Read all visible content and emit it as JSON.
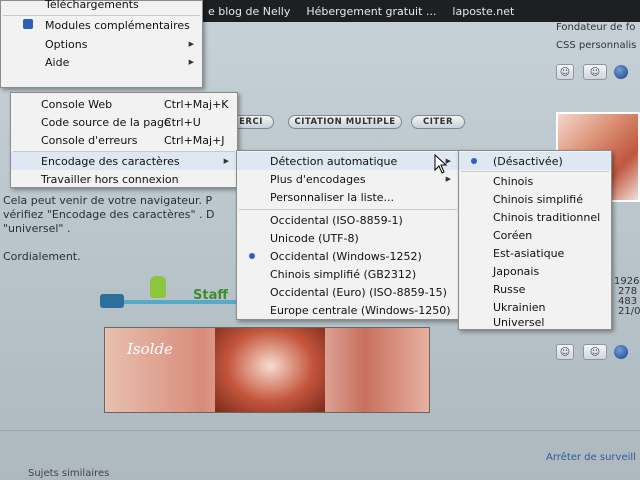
{
  "browser_tabs": [
    "e blog de Nelly",
    "Hébergement gratuit ...",
    "laposte.net"
  ],
  "tools_menu": {
    "partial_top": "Téléchargements",
    "items": [
      {
        "label": "Modules complémentaires",
        "icon": "puzzle-icon"
      },
      {
        "label": "Options"
      },
      {
        "label": "Aide"
      }
    ]
  },
  "dev_menu": {
    "items": [
      {
        "label": "Console Web",
        "shortcut": "Ctrl+Maj+K"
      },
      {
        "label": "Code source de la page",
        "shortcut": "Ctrl+U"
      },
      {
        "label": "Console d'erreurs",
        "shortcut": "Ctrl+Maj+J"
      },
      {
        "label": "Encodage des caractères"
      },
      {
        "label": "Travailler hors connexion"
      }
    ]
  },
  "encoding_menu": {
    "items": [
      {
        "label": "Détection automatique"
      },
      {
        "label": "Plus d'encodages"
      },
      {
        "label": "Personnaliser la liste..."
      },
      {
        "label": "Occidental (ISO-8859-1)"
      },
      {
        "label": "Unicode (UTF-8)"
      },
      {
        "label": "Occidental (Windows-1252)",
        "selected": true
      },
      {
        "label": "Chinois simplifié (GB2312)"
      },
      {
        "label": "Occidental (Euro) (ISO-8859-15)"
      },
      {
        "label": "Europe centrale (Windows-1250)"
      }
    ]
  },
  "detection_menu": {
    "items": [
      {
        "label": "(Désactivée)",
        "selected": true
      },
      {
        "label": "Chinois"
      },
      {
        "label": "Chinois simplifié"
      },
      {
        "label": "Chinois traditionnel"
      },
      {
        "label": "Coréen"
      },
      {
        "label": "Est-asiatique"
      },
      {
        "label": "Japonais"
      },
      {
        "label": "Russe"
      },
      {
        "label": "Ukrainien"
      },
      {
        "label": "Universel"
      }
    ]
  },
  "page": {
    "right_top_1": "Fondateur de fo",
    "right_top_2": "CSS personnalis",
    "buttons": [
      "ERCI",
      "CITATION MULTIPLE",
      "CITER"
    ],
    "post_line1": "Cela peut venir de votre navigateur. P",
    "post_line2": "vérifiez \"Encodage des caractères\" . D",
    "post_line3": "\"universel\" .",
    "post_line4": "Cordialement.",
    "staff_label": "Staff",
    "banner_name": "Isolde",
    "stats": [
      "1926",
      "278",
      "483",
      "21/0"
    ],
    "bottom_link": "Arrêter de surveill",
    "bottom_left": "Sujets similaires"
  },
  "colors": {
    "accent_bullet": "#2a5fd0",
    "menu_bg": "#f2f2f2",
    "highlight": "#dfe7f2"
  }
}
